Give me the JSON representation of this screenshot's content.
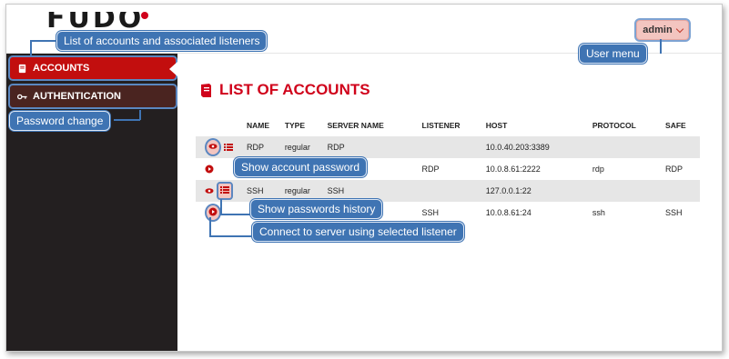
{
  "header": {
    "logo_text": "FUDO",
    "user_label": "admin"
  },
  "sidebar": {
    "items": [
      {
        "label": "ACCOUNTS",
        "icon": "book-icon"
      },
      {
        "label": "AUTHENTICATION",
        "icon": "key-icon"
      }
    ]
  },
  "main": {
    "title": "LIST OF ACCOUNTS",
    "columns": [
      "NAME",
      "TYPE",
      "SERVER NAME",
      "LISTENER",
      "HOST",
      "PROTOCOL",
      "SAFE"
    ],
    "rows": [
      {
        "name": "RDP",
        "type": "regular",
        "server": "RDP",
        "listener": "",
        "host": "10.0.40.203:3389",
        "protocol": "",
        "safe": ""
      },
      {
        "name": "",
        "type": "",
        "server": "",
        "listener": "RDP",
        "host": "10.0.8.61:2222",
        "protocol": "rdp",
        "safe": "RDP"
      },
      {
        "name": "SSH",
        "type": "regular",
        "server": "SSH",
        "listener": "",
        "host": "127.0.0.1:22",
        "protocol": "",
        "safe": ""
      },
      {
        "name": "",
        "type": "",
        "server": "",
        "listener": "SSH",
        "host": "10.0.8.61:24",
        "protocol": "ssh",
        "safe": "SSH"
      }
    ]
  },
  "callouts": {
    "accounts_list": "List of accounts and associated listeners",
    "user_menu": "User menu",
    "password_change": "Password change",
    "show_password": "Show account password",
    "password_history": "Show passwords history",
    "connect": "Connect to server using selected listener"
  },
  "colors": {
    "accent_red": "#c20e0e",
    "callout_blue": "#3f74b3",
    "sidebar_bg": "#231f20"
  }
}
